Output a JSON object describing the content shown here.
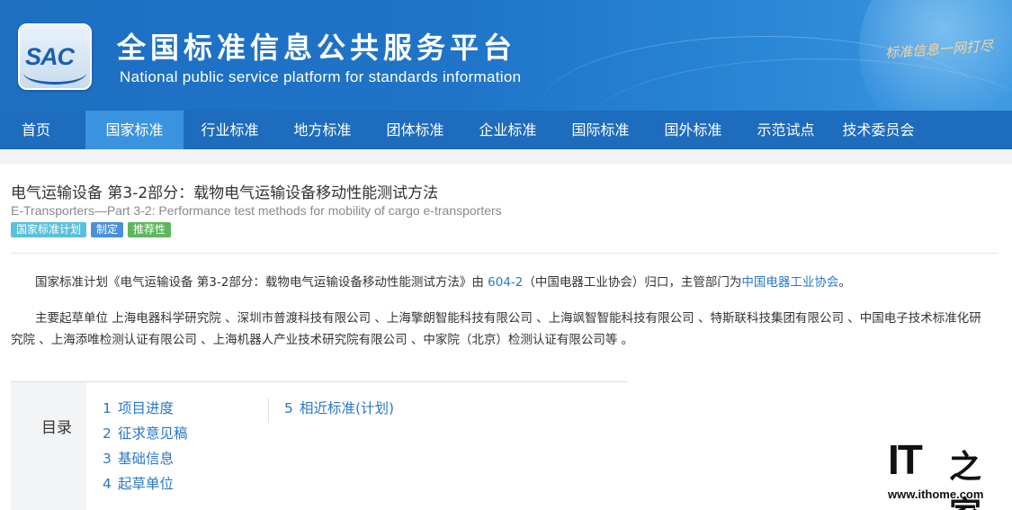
{
  "header": {
    "logo_text": "SAC",
    "title": "全国标准信息公共服务平台",
    "subtitle": "National public service platform  for standards information",
    "slogan": "标准信息一网打尽"
  },
  "nav": {
    "items": [
      {
        "label": "首页"
      },
      {
        "label": "国家标准",
        "active": true
      },
      {
        "label": "行业标准"
      },
      {
        "label": "地方标准"
      },
      {
        "label": "团体标准"
      },
      {
        "label": "企业标准"
      },
      {
        "label": "国际标准"
      },
      {
        "label": "国外标准"
      },
      {
        "label": "示范试点"
      },
      {
        "label": "技术委员会"
      }
    ]
  },
  "standard": {
    "title": "电气运输设备 第3-2部分：载物电气运输设备移动性能测试方法",
    "english_title": "E-Transporters—Part 3-2: Performance test methods for mobility of cargo e-transporters",
    "tags": [
      {
        "label": "国家标准计划",
        "color": "#5bc0de"
      },
      {
        "label": "制定",
        "color": "#4a90d9"
      },
      {
        "label": "推荐性",
        "color": "#5cb85c"
      }
    ]
  },
  "description": {
    "p1_prefix": "国家标准计划《电气运输设备 第3-2部分：载物电气运输设备移动性能测试方法》由 ",
    "p1_committee_code": "604-2",
    "p1_middle": "（中国电器工业协会）归口，主管部门为",
    "p1_department": "中国电器工业协会",
    "p1_suffix": "。",
    "p2": "主要起草单位 上海电器科学研究院 、深圳市普渡科技有限公司 、上海擎朗智能科技有限公司 、上海飒智智能科技有限公司 、特斯联科技集团有限公司 、中国电子技术标准化研究院 、上海添唯检测认证有限公司 、上海机器人产业技术研究院有限公司 、中家院（北京）检测认证有限公司等 。"
  },
  "toc": {
    "label": "目录",
    "items": [
      {
        "num": "1",
        "label": "项目进度"
      },
      {
        "num": "2",
        "label": "征求意见稿"
      },
      {
        "num": "3",
        "label": "基础信息"
      },
      {
        "num": "4",
        "label": "起草单位"
      },
      {
        "num": "5",
        "label": "相近标准(计划)"
      }
    ]
  },
  "watermark": {
    "brand": "IT",
    "brand_cn": "之家",
    "url": "www.ithome.com"
  }
}
